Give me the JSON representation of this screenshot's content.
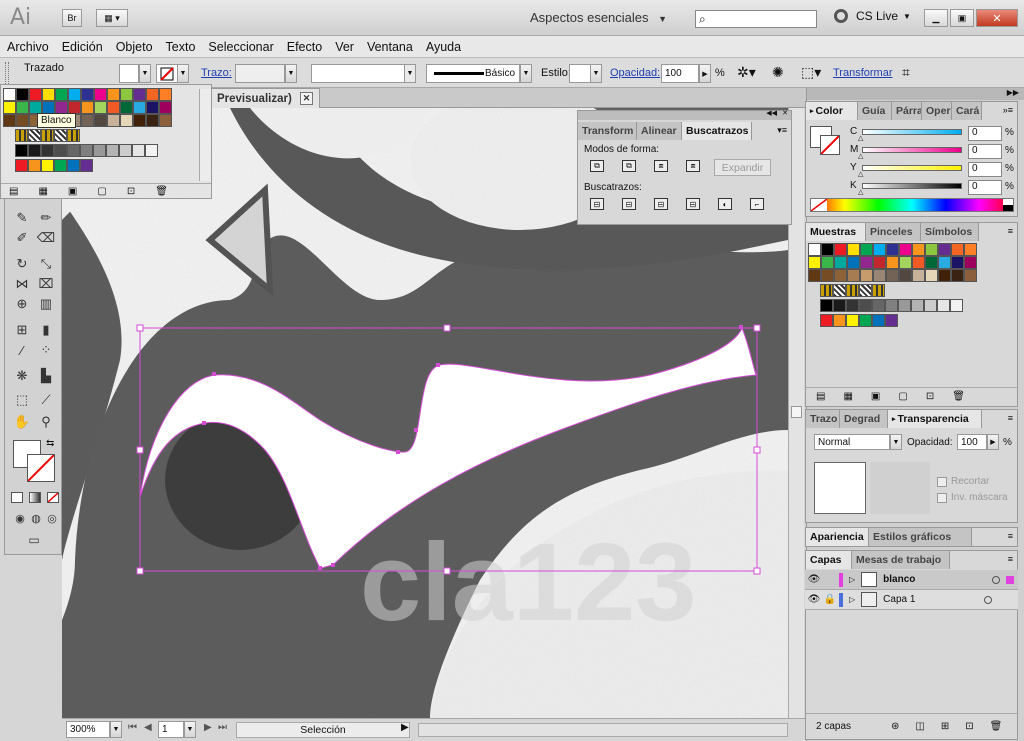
{
  "app": {
    "logo": "Ai",
    "bridge": "Br",
    "workspace": "Aspectos esenciales",
    "search_placeholder": "",
    "cs_live": "CS Live"
  },
  "window_controls": {
    "minimize": "▁",
    "restore": "▣",
    "close": "✕"
  },
  "menu": [
    "Archivo",
    "Edición",
    "Objeto",
    "Texto",
    "Seleccionar",
    "Efecto",
    "Ver",
    "Ventana",
    "Ayuda"
  ],
  "control_bar": {
    "selection_label": "Trazado",
    "stroke_label": "Trazo:",
    "stroke_style": "Básico",
    "style_label": "Estilo:",
    "opacity_label": "Opacidad:",
    "opacity_value": "100",
    "opacity_unit": "%",
    "transform_link": "Transformar"
  },
  "document": {
    "tab_title": "Previsualizar)",
    "watermark": "cla123"
  },
  "swatch_popup": {
    "tooltip": "Blanco"
  },
  "pathfinder": {
    "tabs": [
      "Transform",
      "Alinear",
      "Buscatrazos"
    ],
    "shape_modes_label": "Modos de forma:",
    "expand_label": "Expandir",
    "pathfinders_label": "Buscatrazos:"
  },
  "color_panel": {
    "tabs": [
      "Color",
      "Guía",
      "Párra",
      "Oper",
      "Cará"
    ],
    "channels": [
      {
        "label": "C",
        "value": "0"
      },
      {
        "label": "M",
        "value": "0"
      },
      {
        "label": "Y",
        "value": "0"
      },
      {
        "label": "K",
        "value": "0"
      }
    ]
  },
  "swatches_panel": {
    "tabs": [
      "Muestras",
      "Pinceles",
      "Símbolos"
    ]
  },
  "transparency_panel": {
    "tabs": [
      "Trazo",
      "Degrad",
      "Transparencia"
    ],
    "blend_mode": "Normal",
    "opacity_label": "Opacidad:",
    "opacity_value": "100",
    "opacity_unit": "%",
    "clip_label": "Recortar",
    "invert_mask_label": "Inv. máscara"
  },
  "appearance_panel": {
    "tabs": [
      "Apariencia",
      "Estilos gráficos"
    ]
  },
  "layers_panel": {
    "tabs": [
      "Capas",
      "Mesas de trabajo"
    ],
    "layers": [
      {
        "name": "blanco"
      },
      {
        "name": "Capa 1"
      }
    ],
    "footer_count": "2 capas"
  },
  "status": {
    "zoom": "300%",
    "artboard": "1",
    "tool": "Selección"
  },
  "colors": {
    "selection_magenta": "#e040e0",
    "link_blue": "#1f3fb0",
    "ui_gray": "#d6d6d6"
  },
  "swatch_grid": [
    [
      "#ffffff",
      "#000000",
      "#ed1c24",
      "#ffde00",
      "#00a651",
      "#00aeef",
      "#2e3192",
      "#ec008c",
      "#f7941d",
      "#8dc63f",
      "#662d91",
      "#f26522",
      "#ff7f27"
    ],
    [
      "#fff200",
      "#39b54a",
      "#00a99d",
      "#0072bc",
      "#92278f",
      "#c1272d",
      "#f7941d",
      "#a3d55e",
      "#f15a24",
      "#006837",
      "#29abe2",
      "#1b1464",
      "#9e005d"
    ],
    [
      "#603813",
      "#754c24",
      "#8c6239",
      "#a67c52",
      "#c69c6d",
      "#998675",
      "#736357",
      "#534741",
      "#c7b299",
      "#e6d6b8",
      "#42210b",
      "#3b2314",
      "#8b5e3c"
    ]
  ],
  "gray_swatches": [
    "#000000",
    "#1a1a1a",
    "#333333",
    "#4d4d4d",
    "#666666",
    "#808080",
    "#999999",
    "#b3b3b3",
    "#cccccc",
    "#e6e6e6",
    "#f2f2f2"
  ],
  "bright_swatches": [
    "#ed1c24",
    "#f7941d",
    "#fff200",
    "#00a651",
    "#0072bc",
    "#662d91"
  ]
}
